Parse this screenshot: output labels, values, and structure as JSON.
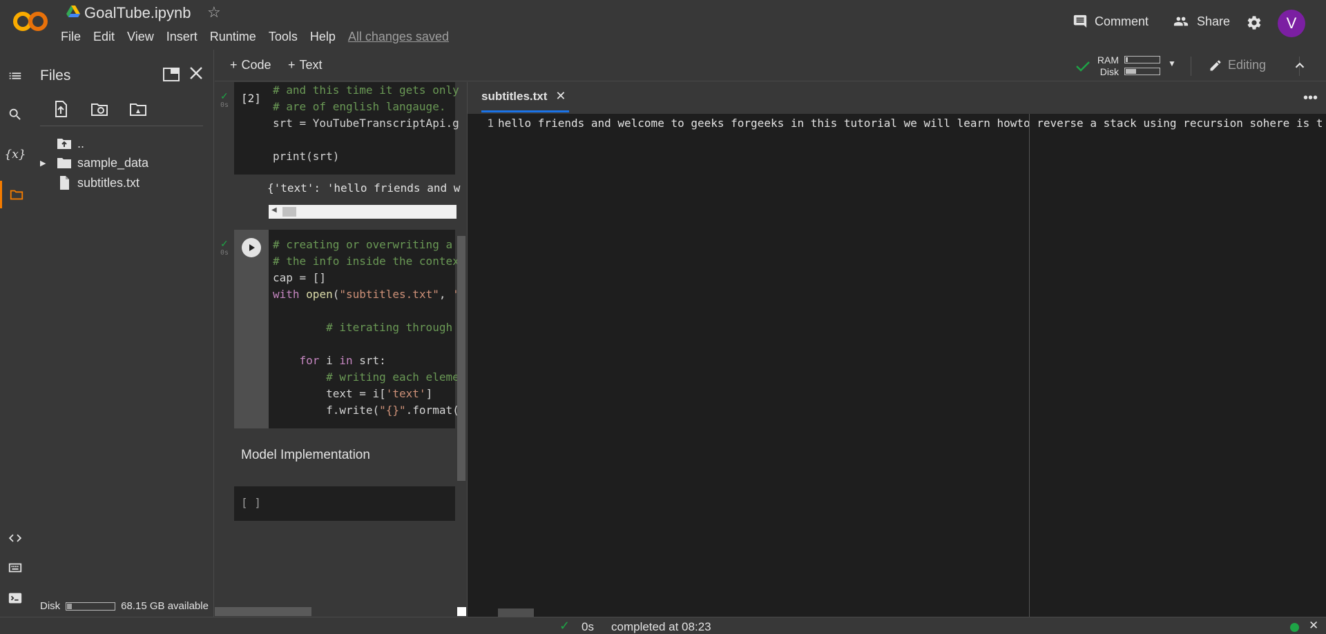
{
  "app": {
    "notebook_title": "GoalTube.ipynb",
    "menu": [
      "File",
      "Edit",
      "View",
      "Insert",
      "Runtime",
      "Tools",
      "Help"
    ],
    "save_status": "All changes saved",
    "comment_label": "Comment",
    "share_label": "Share",
    "avatar_letter": "V",
    "logo_text": "CO",
    "logo_color": "#f9ab00",
    "avatar_color": "#7b1fa2"
  },
  "files_panel": {
    "title": "Files",
    "tree": [
      {
        "name": "..",
        "type": "parent-folder"
      },
      {
        "name": "sample_data",
        "type": "folder"
      },
      {
        "name": "subtitles.txt",
        "type": "file"
      }
    ],
    "disk_label": "Disk",
    "disk_available": "68.15 GB available",
    "disk_used_fraction": 0.1
  },
  "toolbar": {
    "add_code": "Code",
    "add_text": "Text",
    "ram_label": "RAM",
    "disk_label": "Disk",
    "ram_fraction": 0.05,
    "disk_fraction": 0.3,
    "editing_label": "Editing"
  },
  "cells": {
    "cell1": {
      "exec_count": "[2]",
      "time": "0s",
      "lines": [
        "# and this time it gets only",
        "# are of english langauge.",
        "srt = YouTubeTranscriptApi.g",
        "",
        "print(srt)"
      ],
      "output": "{'text': 'hello friends and w"
    },
    "cell2": {
      "time": "0s",
      "lines": [
        "# creating or overwriting a",
        "# the info inside the contex",
        "cap = []",
        "with open(\"subtitles.txt\", '",
        "",
        "        # iterating through",
        "",
        "    for i in srt:",
        "        # writing each eleme",
        "        text = i['text']",
        "        f.write(\"{}\".format("
      ]
    },
    "text_cell": "Model Implementation",
    "empty_cell": "[ ]"
  },
  "editor": {
    "tab_label": "subtitles.txt",
    "line_number": "1",
    "line_text": "hello friends and welcome to geeks forgeeks in this tutorial we will learn howto reverse a stack using recursion sohere is th"
  },
  "statusbar": {
    "time": "0s",
    "message": "completed at 08:23",
    "indicator_color": "#1ea446"
  }
}
